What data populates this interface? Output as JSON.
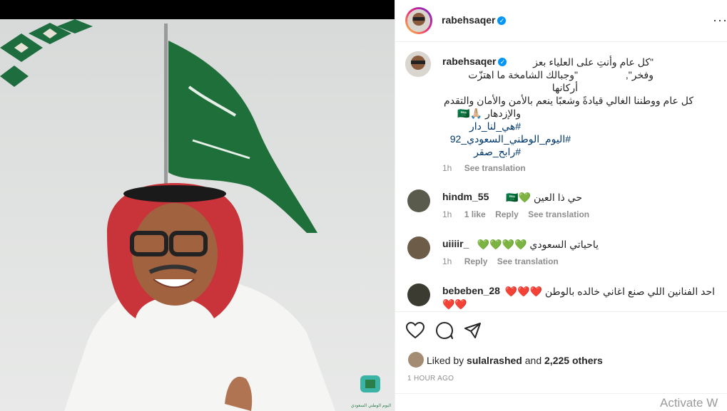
{
  "post": {
    "username": "rabehsaqer",
    "caption_line1": "\"كل عام وأنتِ على العلياء بعز وفخر\",",
    "caption_line2": "\"وجبالك الشامخة ما اهتزّت أركانها",
    "caption_line3": "كل عام ووطننا الغالي قيادةً وشعبًا ينعم بالأمن والأمان والتقدم",
    "caption_line4": "والإزدهار 🙏🏼🇸🇦",
    "hashtags": [
      "#هي_لنا_دار",
      "#اليوم_الوطني_السعودي_92",
      "#رابح_صقر"
    ],
    "time": "1h",
    "see_translation": "See translation",
    "likes_text_prefix": "Liked by",
    "likes_user": "sulalrashed",
    "likes_and": "and",
    "likes_others": "2,225 others",
    "timestamp": "1 HOUR AGO",
    "watermark": "Activate W"
  },
  "comments": [
    {
      "username": "hindm_55",
      "text": "حي ذا العين 💚🇸🇦",
      "time": "1h",
      "likes": "1 like",
      "reply": "Reply",
      "translate": "See translation"
    },
    {
      "username": "uiiiir_",
      "text": "ياحياتي السعودي 💚💚💚💚",
      "time": "1h",
      "reply": "Reply",
      "translate": "See translation"
    },
    {
      "username": "bebeben_28",
      "text": "احد الفنانين اللي صنع اغاني خالده بالوطن ❤️❤️❤️",
      "text2": "❤️❤️"
    }
  ],
  "logo_text": "اليوم الوطني السعودي",
  "colors": {
    "verified": "#0095f6",
    "link": "#00376b",
    "meta": "#8e8e8e",
    "flag": "#1f6f3a"
  },
  "icons": [
    "heart-icon",
    "comment-icon",
    "share-icon",
    "more-icon",
    "verified-icon"
  ]
}
